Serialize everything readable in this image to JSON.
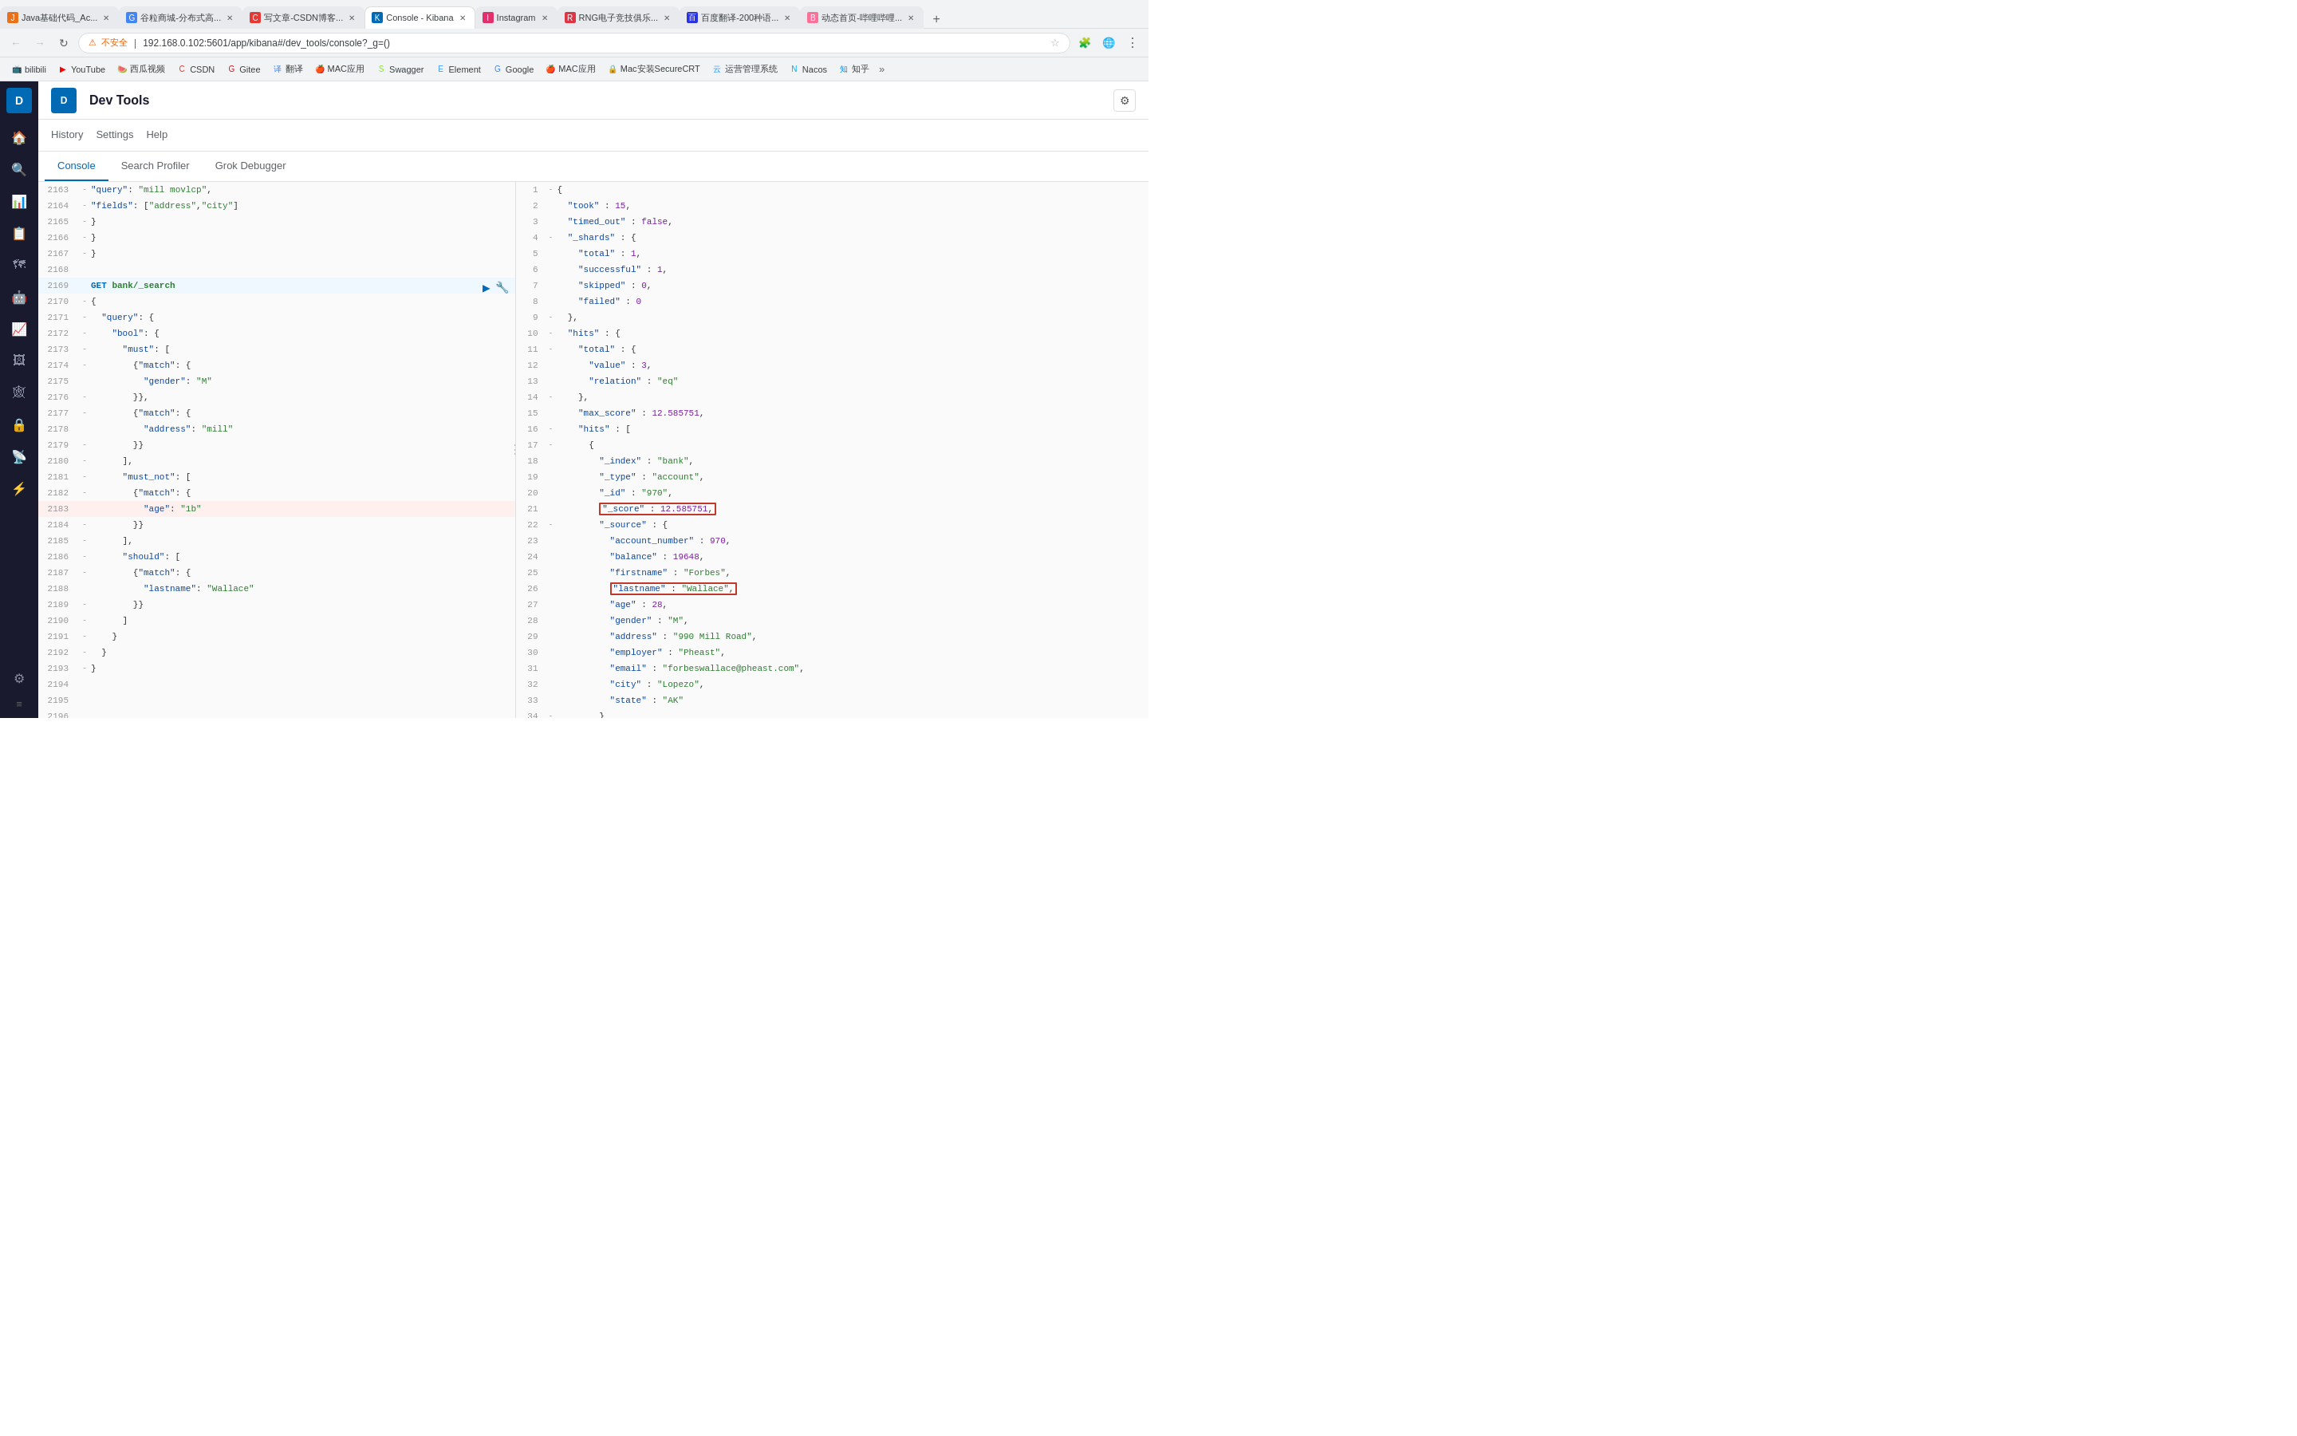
{
  "browser": {
    "tabs": [
      {
        "id": "java",
        "title": "Java基础代码_Ac...",
        "favicon_color": "#e8711a",
        "favicon_text": "J",
        "active": false
      },
      {
        "id": "谷粒",
        "title": "谷粒商城-分布式高...",
        "favicon_color": "#4285f4",
        "favicon_text": "G",
        "active": false
      },
      {
        "id": "csdn",
        "title": "写文章-CSDN博客...",
        "favicon_color": "#e53935",
        "favicon_text": "C",
        "active": false
      },
      {
        "id": "kibana",
        "title": "Console - Kibana",
        "favicon_color": "#006bb4",
        "favicon_text": "K",
        "active": true
      },
      {
        "id": "instagram",
        "title": "Instagram",
        "favicon_color": "#e1306c",
        "favicon_text": "I",
        "active": false
      },
      {
        "id": "rng",
        "title": "RNG电子竞技俱乐...",
        "favicon_color": "#dc3545",
        "favicon_text": "R",
        "active": false
      },
      {
        "id": "baidu",
        "title": "百度翻译-200种语...",
        "favicon_color": "#2932e1",
        "favicon_text": "百",
        "active": false
      },
      {
        "id": "dynamic",
        "title": "动态首页-哔哩哔哩...",
        "favicon_color": "#fb7299",
        "favicon_text": "B",
        "active": false
      }
    ],
    "address": "192.168.0.102:5601/app/kibana#/dev_tools/console?_g=()",
    "address_prefix": "不安全"
  },
  "bookmarks": [
    {
      "id": "bilibili",
      "label": "bilibili",
      "color": "#fb7299"
    },
    {
      "id": "youtube",
      "label": "YouTube",
      "color": "#ff0000"
    },
    {
      "id": "xiguashipin",
      "label": "西瓜视频",
      "color": "#ff6400"
    },
    {
      "id": "csdn",
      "label": "CSDN",
      "color": "#e53935"
    },
    {
      "id": "gitee",
      "label": "Gitee",
      "color": "#c71d23"
    },
    {
      "id": "fanyi",
      "label": "翻译",
      "color": "#4285f4"
    },
    {
      "id": "mac_app",
      "label": "MAC应用",
      "color": "#555"
    },
    {
      "id": "swagger",
      "label": "Swagger",
      "color": "#85ea2d"
    },
    {
      "id": "element",
      "label": "Element",
      "color": "#409eff"
    },
    {
      "id": "google",
      "label": "Google",
      "color": "#4285f4"
    },
    {
      "id": "mac_app2",
      "label": "MAC应用",
      "color": "#555"
    },
    {
      "id": "securecrt",
      "label": "Mac安装SecureCRT",
      "color": "#555"
    },
    {
      "id": "yunying",
      "label": "运营管理系统",
      "color": "#1890ff"
    },
    {
      "id": "nacos",
      "label": "Nacos",
      "color": "#00adef"
    },
    {
      "id": "zhihu",
      "label": "知乎",
      "color": "#0084ff"
    }
  ],
  "app": {
    "title": "Dev Tools",
    "subnav": [
      "History",
      "Settings",
      "Help"
    ],
    "tabs": [
      "Console",
      "Search Profiler",
      "Grok Debugger"
    ]
  },
  "editor": {
    "lines": [
      {
        "num": 2163,
        "gutter": "-",
        "content": "  \"query\": \"mill movlcp\","
      },
      {
        "num": 2164,
        "gutter": "-",
        "content": "  \"fields\": [\"address\",\"city\"]"
      },
      {
        "num": 2165,
        "gutter": "-",
        "content": "}"
      },
      {
        "num": 2166,
        "gutter": "-",
        "content": "}"
      },
      {
        "num": 2167,
        "gutter": "-",
        "content": "}"
      },
      {
        "num": 2168,
        "gutter": "",
        "content": ""
      },
      {
        "num": 2169,
        "gutter": "",
        "content": "GET bank/_search",
        "is_get": true
      },
      {
        "num": 2170,
        "gutter": "-",
        "content": "{"
      },
      {
        "num": 2171,
        "gutter": "-",
        "content": "  \"query\": {"
      },
      {
        "num": 2172,
        "gutter": "-",
        "content": "    \"bool\": {"
      },
      {
        "num": 2173,
        "gutter": "-",
        "content": "      \"must\": ["
      },
      {
        "num": 2174,
        "gutter": "-",
        "content": "        {\"match\": {"
      },
      {
        "num": 2175,
        "gutter": "",
        "content": "          \"gender\": \"M\""
      },
      {
        "num": 2176,
        "gutter": "-",
        "content": "        }},"
      },
      {
        "num": 2177,
        "gutter": "-",
        "content": "        {\"match\": {"
      },
      {
        "num": 2178,
        "gutter": "",
        "content": "          \"address\": \"mill\""
      },
      {
        "num": 2179,
        "gutter": "-",
        "content": "        }}"
      },
      {
        "num": 2180,
        "gutter": "-",
        "content": "      ],"
      },
      {
        "num": 2181,
        "gutter": "-",
        "content": "      \"must_not\": ["
      },
      {
        "num": 2182,
        "gutter": "-",
        "content": "        {\"match\": {"
      },
      {
        "num": 2183,
        "gutter": "",
        "content": "          \"age\": \"1b\""
      },
      {
        "num": 2184,
        "gutter": "-",
        "content": "        }}"
      },
      {
        "num": 2185,
        "gutter": "-",
        "content": "      ],"
      },
      {
        "num": 2186,
        "gutter": "-",
        "content": "      \"should\": ["
      },
      {
        "num": 2187,
        "gutter": "-",
        "content": "        {\"match\": {"
      },
      {
        "num": 2188,
        "gutter": "",
        "content": "          \"lastname\": \"Wallace\""
      },
      {
        "num": 2189,
        "gutter": "-",
        "content": "        }}"
      },
      {
        "num": 2190,
        "gutter": "-",
        "content": "      ]"
      },
      {
        "num": 2191,
        "gutter": "-",
        "content": "    }"
      },
      {
        "num": 2192,
        "gutter": "-",
        "content": "  }"
      },
      {
        "num": 2193,
        "gutter": "-",
        "content": "}"
      },
      {
        "num": 2194,
        "gutter": "",
        "content": ""
      },
      {
        "num": 2195,
        "gutter": "",
        "content": ""
      },
      {
        "num": 2196,
        "gutter": "",
        "content": ""
      }
    ]
  },
  "response": {
    "lines": [
      {
        "num": 1,
        "gutter": "-",
        "content": "{"
      },
      {
        "num": 2,
        "gutter": "",
        "content": "  \"took\" : 15,"
      },
      {
        "num": 3,
        "gutter": "",
        "content": "  \"timed_out\" : false,"
      },
      {
        "num": 4,
        "gutter": "-",
        "content": "  \"_shards\" : {"
      },
      {
        "num": 5,
        "gutter": "",
        "content": "    \"total\" : 1,"
      },
      {
        "num": 6,
        "gutter": "",
        "content": "    \"successful\" : 1,"
      },
      {
        "num": 7,
        "gutter": "",
        "content": "    \"skipped\" : 0,"
      },
      {
        "num": 8,
        "gutter": "",
        "content": "    \"failed\" : 0"
      },
      {
        "num": 9,
        "gutter": "-",
        "content": "  },"
      },
      {
        "num": 10,
        "gutter": "-",
        "content": "  \"hits\" : {"
      },
      {
        "num": 11,
        "gutter": "-",
        "content": "    \"total\" : {"
      },
      {
        "num": 12,
        "gutter": "",
        "content": "      \"value\" : 3,"
      },
      {
        "num": 13,
        "gutter": "",
        "content": "      \"relation\" : \"eq\""
      },
      {
        "num": 14,
        "gutter": "-",
        "content": "    },"
      },
      {
        "num": 15,
        "gutter": "",
        "content": "    \"max_score\" : 12.585751,"
      },
      {
        "num": 16,
        "gutter": "-",
        "content": "    \"hits\" : ["
      },
      {
        "num": 17,
        "gutter": "-",
        "content": "      {"
      },
      {
        "num": 18,
        "gutter": "",
        "content": "        \"_index\" : \"bank\","
      },
      {
        "num": 19,
        "gutter": "",
        "content": "        \"_type\" : \"account\","
      },
      {
        "num": 20,
        "gutter": "",
        "content": "        \"_id\" : \"970\","
      },
      {
        "num": 21,
        "gutter": "",
        "content": "        \"_score\" : 12.585751,",
        "boxed": true
      },
      {
        "num": 22,
        "gutter": "-",
        "content": "        \"_source\" : {"
      },
      {
        "num": 23,
        "gutter": "",
        "content": "          \"account_number\" : 970,"
      },
      {
        "num": 24,
        "gutter": "",
        "content": "          \"balance\" : 19648,"
      },
      {
        "num": 25,
        "gutter": "",
        "content": "          \"firstname\" : \"Forbes\","
      },
      {
        "num": 26,
        "gutter": "",
        "content": "          \"lastname\" : \"Wallace\",",
        "boxed": true
      },
      {
        "num": 27,
        "gutter": "",
        "content": "          \"age\" : 28,"
      },
      {
        "num": 28,
        "gutter": "",
        "content": "          \"gender\" : \"M\","
      },
      {
        "num": 29,
        "gutter": "",
        "content": "          \"address\" : \"990 Mill Road\","
      },
      {
        "num": 30,
        "gutter": "",
        "content": "          \"employer\" : \"Pheast\","
      },
      {
        "num": 31,
        "gutter": "",
        "content": "          \"email\" : \"forbeswallace@pheast.com\","
      },
      {
        "num": 32,
        "gutter": "",
        "content": "          \"city\" : \"Lopezo\","
      },
      {
        "num": 33,
        "gutter": "",
        "content": "          \"state\" : \"AK\""
      },
      {
        "num": 34,
        "gutter": "-",
        "content": "        }"
      }
    ]
  }
}
